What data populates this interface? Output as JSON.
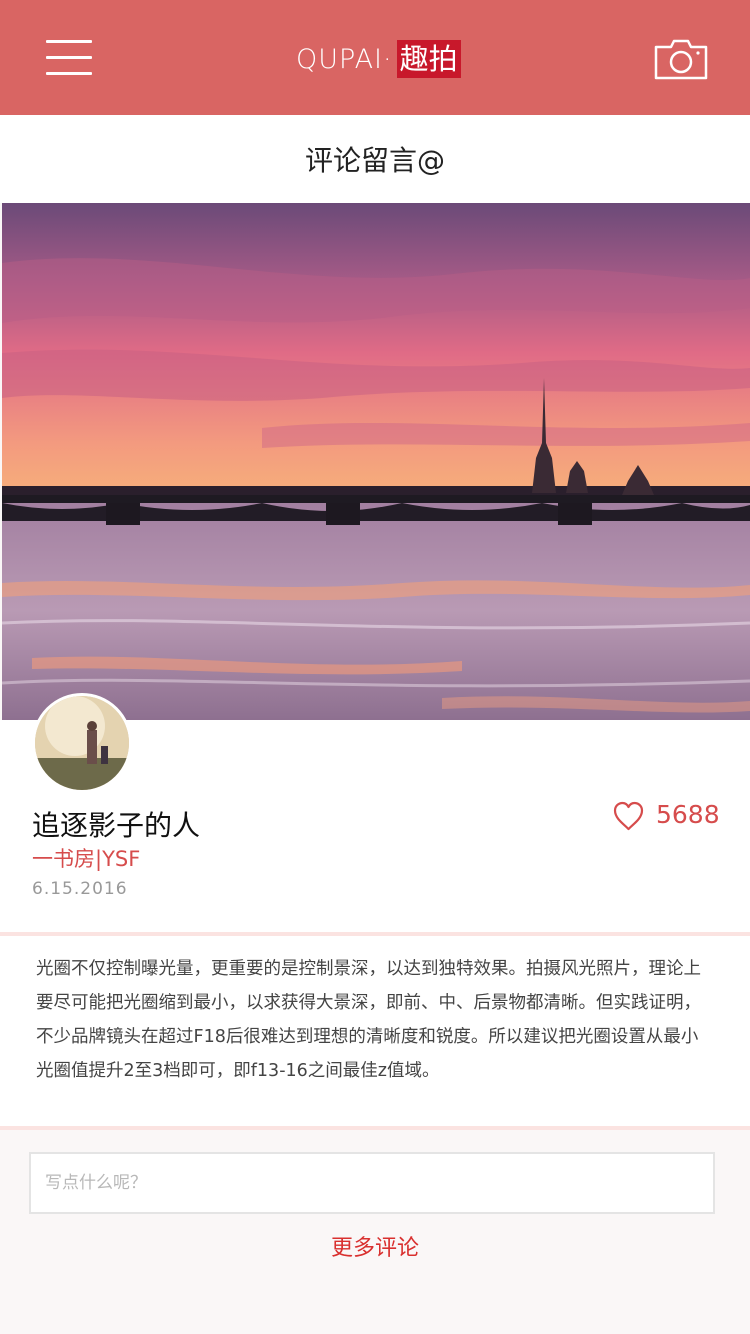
{
  "header": {
    "logo_latin": "QUPAI·",
    "logo_cn": "趣拍",
    "menu_icon": "hamburger-menu-icon",
    "camera_icon": "camera-icon"
  },
  "subbar": {
    "title": "评论留言@"
  },
  "post": {
    "photo_subject": "sunset-over-frozen-river-with-bridge",
    "author_name": "追逐影子的人",
    "studio": "一书房|YSF",
    "date": "6.15.2016",
    "like_icon": "heart-icon",
    "like_count": "5688",
    "text": "光圈不仅控制曝光量，更重要的是控制景深，以达到独特效果。拍摄风光照片，理论上要尽可能把光圈缩到最小，以求获得大景深，即前、中、后景物都清晰。但实践证明，不少品牌镜头在超过F18后很难达到理想的清晰度和锐度。所以建议把光圈设置从最小光圈值提升2至3档即可，即f13-16之间最佳z值域。"
  },
  "comment": {
    "placeholder": "写点什么呢？",
    "more_label": "更多评论"
  },
  "colors": {
    "header_bg": "#d96563",
    "logo_badge": "#c8182b",
    "accent": "#d64c4c",
    "divider": "#fbe3e1"
  }
}
